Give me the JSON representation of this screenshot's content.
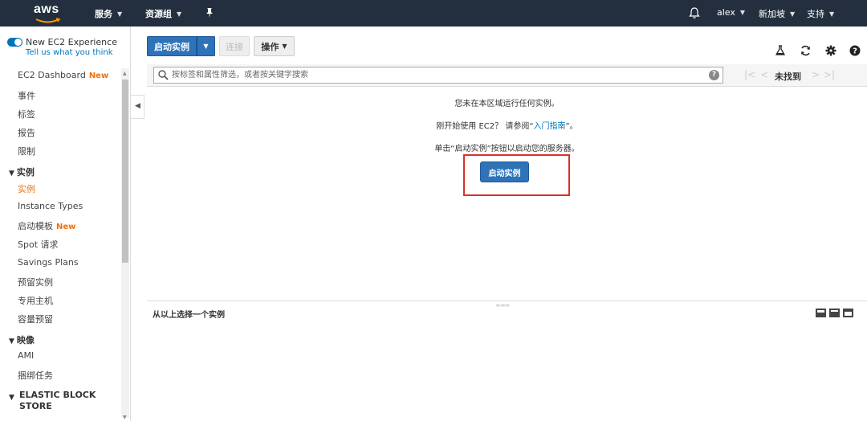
{
  "topnav": {
    "logo": "aws",
    "services": "服务",
    "resource_groups": "资源组",
    "user": "alex",
    "region": "新加坡",
    "support": "支持"
  },
  "sidebar": {
    "new_experience_label": "New EC2 Experience",
    "feedback_link": "Tell us what you think",
    "new_badge": "New",
    "items": {
      "dashboard": "EC2 Dashboard",
      "events": "事件",
      "tags": "标签",
      "reports": "报告",
      "limits": "限制",
      "instances_header": "实例",
      "instances": "实例",
      "instance_types": "Instance Types",
      "launch_templates": "启动模板",
      "spot_requests": "Spot 请求",
      "savings_plans": "Savings Plans",
      "reserved_instances": "预留实例",
      "dedicated_hosts": "专用主机",
      "capacity_reservations": "容量预留",
      "images_header": "映像",
      "ami": "AMI",
      "bundle_tasks": "捆绑任务",
      "ebs_header_line1": "ELASTIC BLOCK",
      "ebs_header_line2": "STORE"
    }
  },
  "toolbar": {
    "launch_instance": "启动实例",
    "connect": "连接",
    "actions": "操作"
  },
  "search": {
    "placeholder": "按标签和属性筛选，或者按关键字搜索",
    "pager_status": "未找到"
  },
  "empty_state": {
    "line1": "您未在本区域运行任何实例。",
    "line2_prefix": "刚开始使用 EC2？ 请参阅“",
    "line2_link": "入门指南",
    "line2_suffix": "”。",
    "line3": "单击“启动实例”按钮以启动您的服务器。",
    "cta_button": "启动实例"
  },
  "bottom_panel": {
    "title": "从以上选择一个实例"
  },
  "colors": {
    "nav_bg": "#232f3e",
    "primary_button": "#2e73b8",
    "accent_orange": "#ec7211",
    "link_blue": "#0073bb",
    "highlight_red": "#d9302b"
  }
}
